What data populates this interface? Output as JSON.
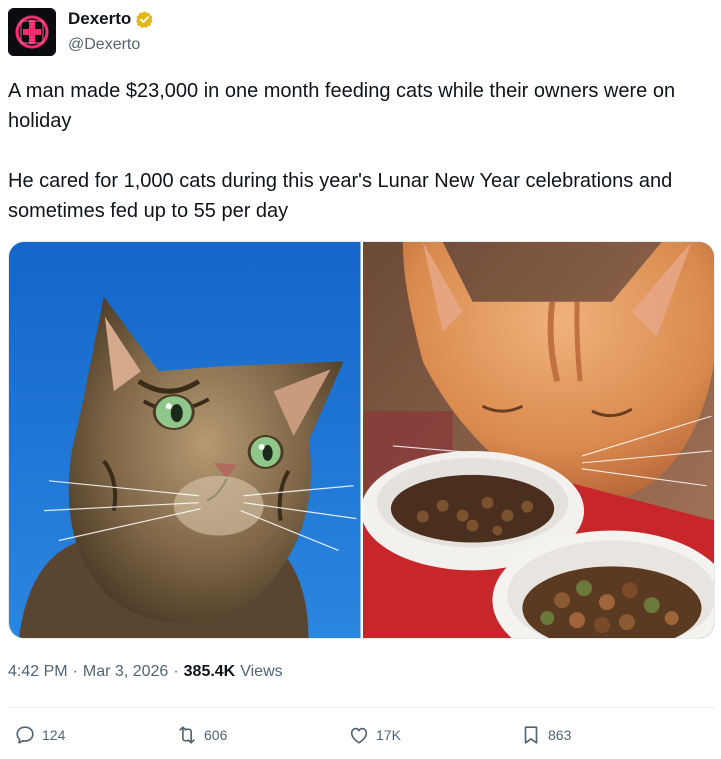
{
  "author": {
    "name": "Dexerto",
    "handle": "@Dexerto",
    "verified_color": "#e2b719",
    "avatar_color": "#ff2d6f"
  },
  "tweet": {
    "paragraph_1": "A man made $23,000 in one month feeding cats while their owners were on holiday",
    "paragraph_2": "He cared for 1,000 cats during this year's Lunar New Year celebrations and sometimes fed up to 55 per day"
  },
  "media": [
    {
      "subject": "tabby cat with green eyes against blue sky"
    },
    {
      "subject": "orange cat eating kibble from white bowl"
    }
  ],
  "meta": {
    "time": "4:42 PM",
    "date": "Mar 3, 2026",
    "views_count": "385.4K",
    "views_label": "Views",
    "separator": "·"
  },
  "actions": {
    "replies": "124",
    "retweets": "606",
    "likes": "17K",
    "bookmarks": "863"
  },
  "icons": {
    "reply": "comment-icon",
    "retweet": "retweet-icon",
    "like": "heart-icon",
    "bookmark": "bookmark-icon"
  }
}
